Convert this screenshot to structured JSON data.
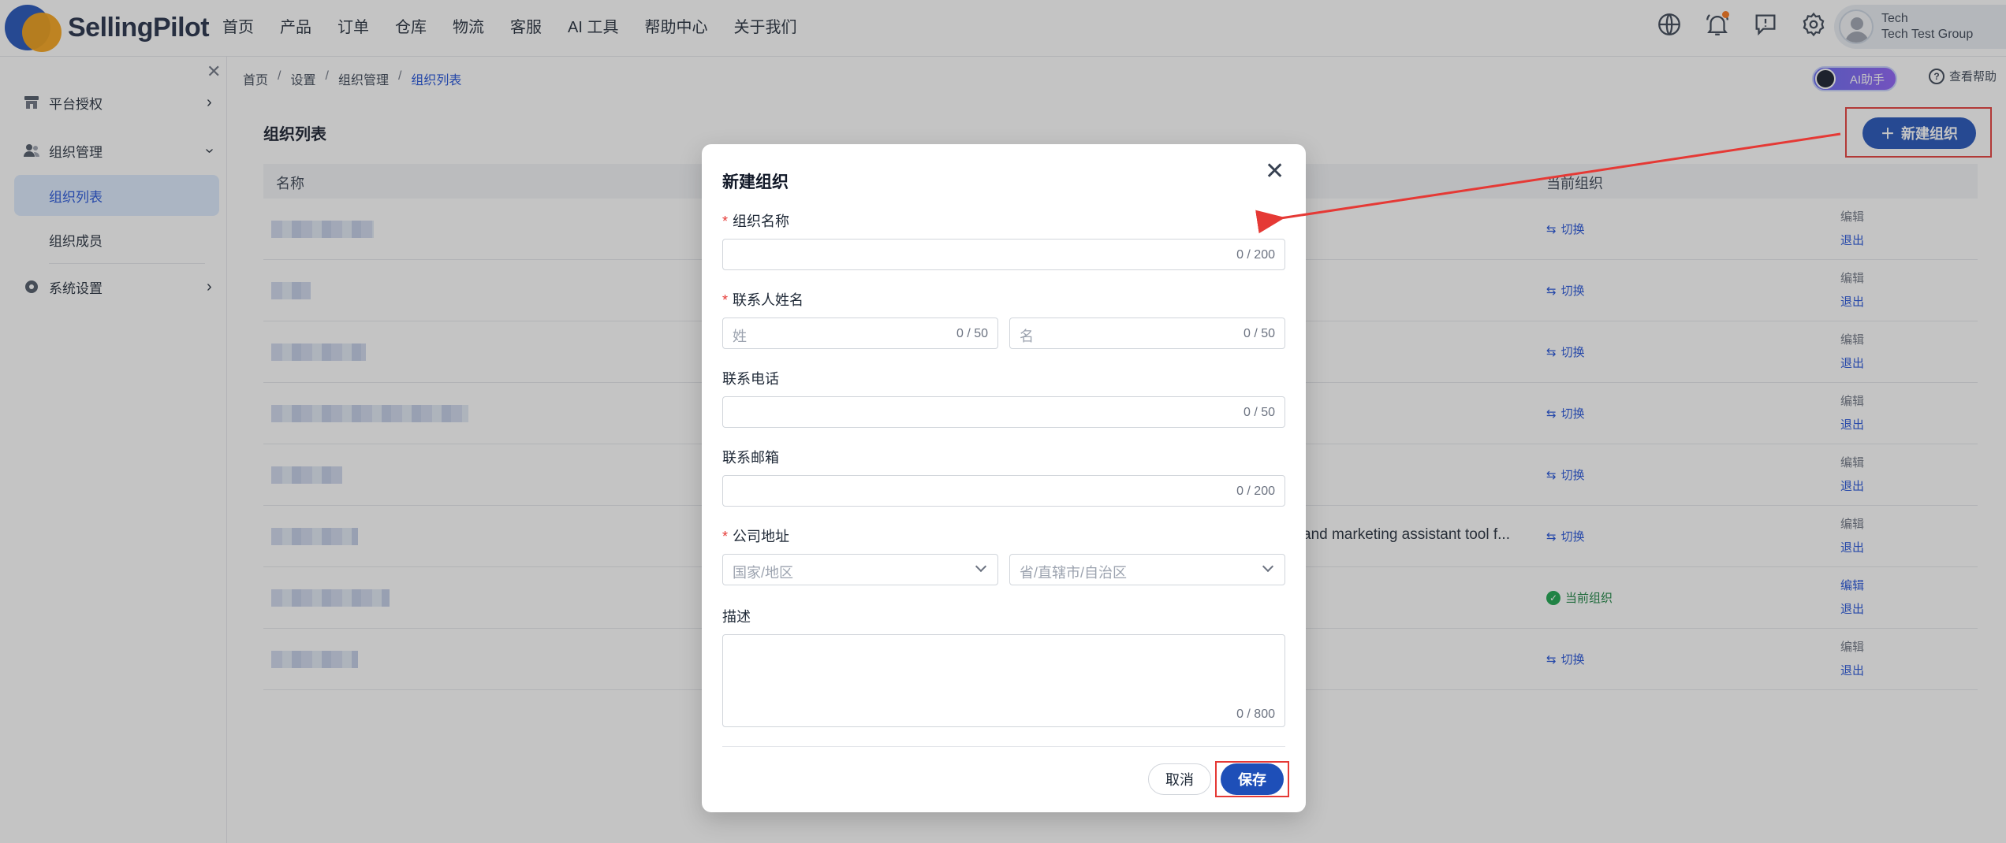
{
  "brand": {
    "name": "SellingPilot"
  },
  "topnav": [
    "首页",
    "产品",
    "订单",
    "仓库",
    "物流",
    "客服",
    "AI 工具",
    "帮助中心",
    "关于我们"
  ],
  "user": {
    "name": "Tech",
    "org": "Tech Test Group"
  },
  "sidebar": {
    "groups": [
      {
        "label": "平台授权",
        "icon": "shop-icon"
      },
      {
        "label": "组织管理",
        "icon": "users-icon"
      },
      {
        "label": "系统设置",
        "icon": "gear-icon"
      }
    ],
    "sub_items": [
      "组织列表",
      "组织成员"
    ]
  },
  "breadcrumb": [
    "首页",
    "设置",
    "组织管理",
    "组织列表"
  ],
  "ai_button": "AI助手",
  "help_link": "查看帮助",
  "page": {
    "title": "组织列表",
    "new_button": "新建组织"
  },
  "table": {
    "headers": [
      "名称",
      "当前组织"
    ],
    "switch_label": "切换",
    "current_label": "当前组织",
    "edit_label": "编辑",
    "exit_label": "退出",
    "truncated_desc": "and marketing assistant tool f...",
    "rows": [
      {
        "state": "switch"
      },
      {
        "state": "switch"
      },
      {
        "state": "switch"
      },
      {
        "state": "switch"
      },
      {
        "state": "switch"
      },
      {
        "state": "switch"
      },
      {
        "state": "current"
      },
      {
        "state": "switch"
      }
    ]
  },
  "modal": {
    "title": "新建组织",
    "org_name": {
      "label": "组织名称",
      "counter": "0 / 200"
    },
    "contact_name": {
      "label": "联系人姓名",
      "last": {
        "placeholder": "姓",
        "counter": "0 / 50"
      },
      "first": {
        "placeholder": "名",
        "counter": "0 / 50"
      }
    },
    "phone": {
      "label": "联系电话",
      "counter": "0 / 50"
    },
    "email": {
      "label": "联系邮箱",
      "counter": "0 / 200"
    },
    "address": {
      "label": "公司地址",
      "country_placeholder": "国家/地区",
      "province_placeholder": "省/直辖市/自治区"
    },
    "description": {
      "label": "描述",
      "counter": "0 / 800"
    },
    "cancel": "取消",
    "save": "保存"
  },
  "colors": {
    "primary": "#1e4fb8",
    "required": "#e53935",
    "annotation": "#e53935",
    "success": "#16a34a"
  }
}
